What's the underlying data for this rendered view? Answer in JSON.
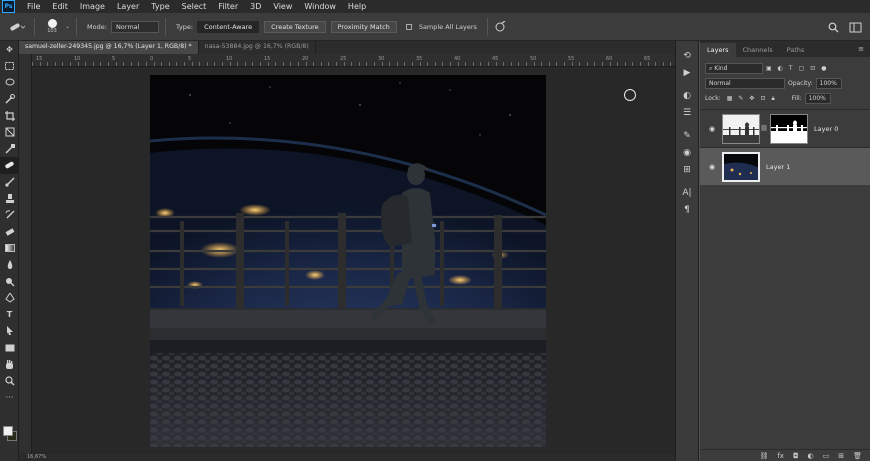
{
  "app": {
    "logo": "Ps"
  },
  "menu": [
    "File",
    "Edit",
    "Image",
    "Layer",
    "Type",
    "Select",
    "Filter",
    "3D",
    "View",
    "Window",
    "Help"
  ],
  "options": {
    "brush_size": "103",
    "mode_label": "Mode:",
    "mode_value": "Normal",
    "type_label": "Type:",
    "type_buttons": [
      "Content-Aware",
      "Create Texture",
      "Proximity Match"
    ],
    "sample_all_layers": "Sample All Layers"
  },
  "doc_tabs": [
    {
      "label": "samuel-zeller-249345.jpg @ 16,7% (Layer 1, RGB/8) *",
      "active": true
    },
    {
      "label": "nasa-53884.jpg @ 16,7% (RGB/8)",
      "active": false
    }
  ],
  "ruler_labels": [
    "15",
    "10",
    "5",
    "0",
    "5",
    "10",
    "15",
    "20",
    "25",
    "30",
    "35",
    "40",
    "45",
    "50",
    "55",
    "60",
    "65"
  ],
  "status": "16,67%",
  "panel_tabs": [
    {
      "label": "Layers",
      "active": true
    },
    {
      "label": "Channels",
      "active": false
    },
    {
      "label": "Paths",
      "active": false
    }
  ],
  "layers_panel": {
    "filter_kind": "Kind",
    "blend_mode": "Normal",
    "opacity_label": "Opacity:",
    "opacity_value": "100%",
    "lock_label": "Lock:",
    "fill_label": "Fill:",
    "fill_value": "100%"
  },
  "layers": [
    {
      "name": "Layer 0",
      "selected": false,
      "has_mask": true
    },
    {
      "name": "Layer 1",
      "selected": true,
      "has_mask": false
    }
  ],
  "colors": {
    "accent": "#31a8ff",
    "canvas_bg": "#282828",
    "panel_bg": "#3c3c3c"
  }
}
